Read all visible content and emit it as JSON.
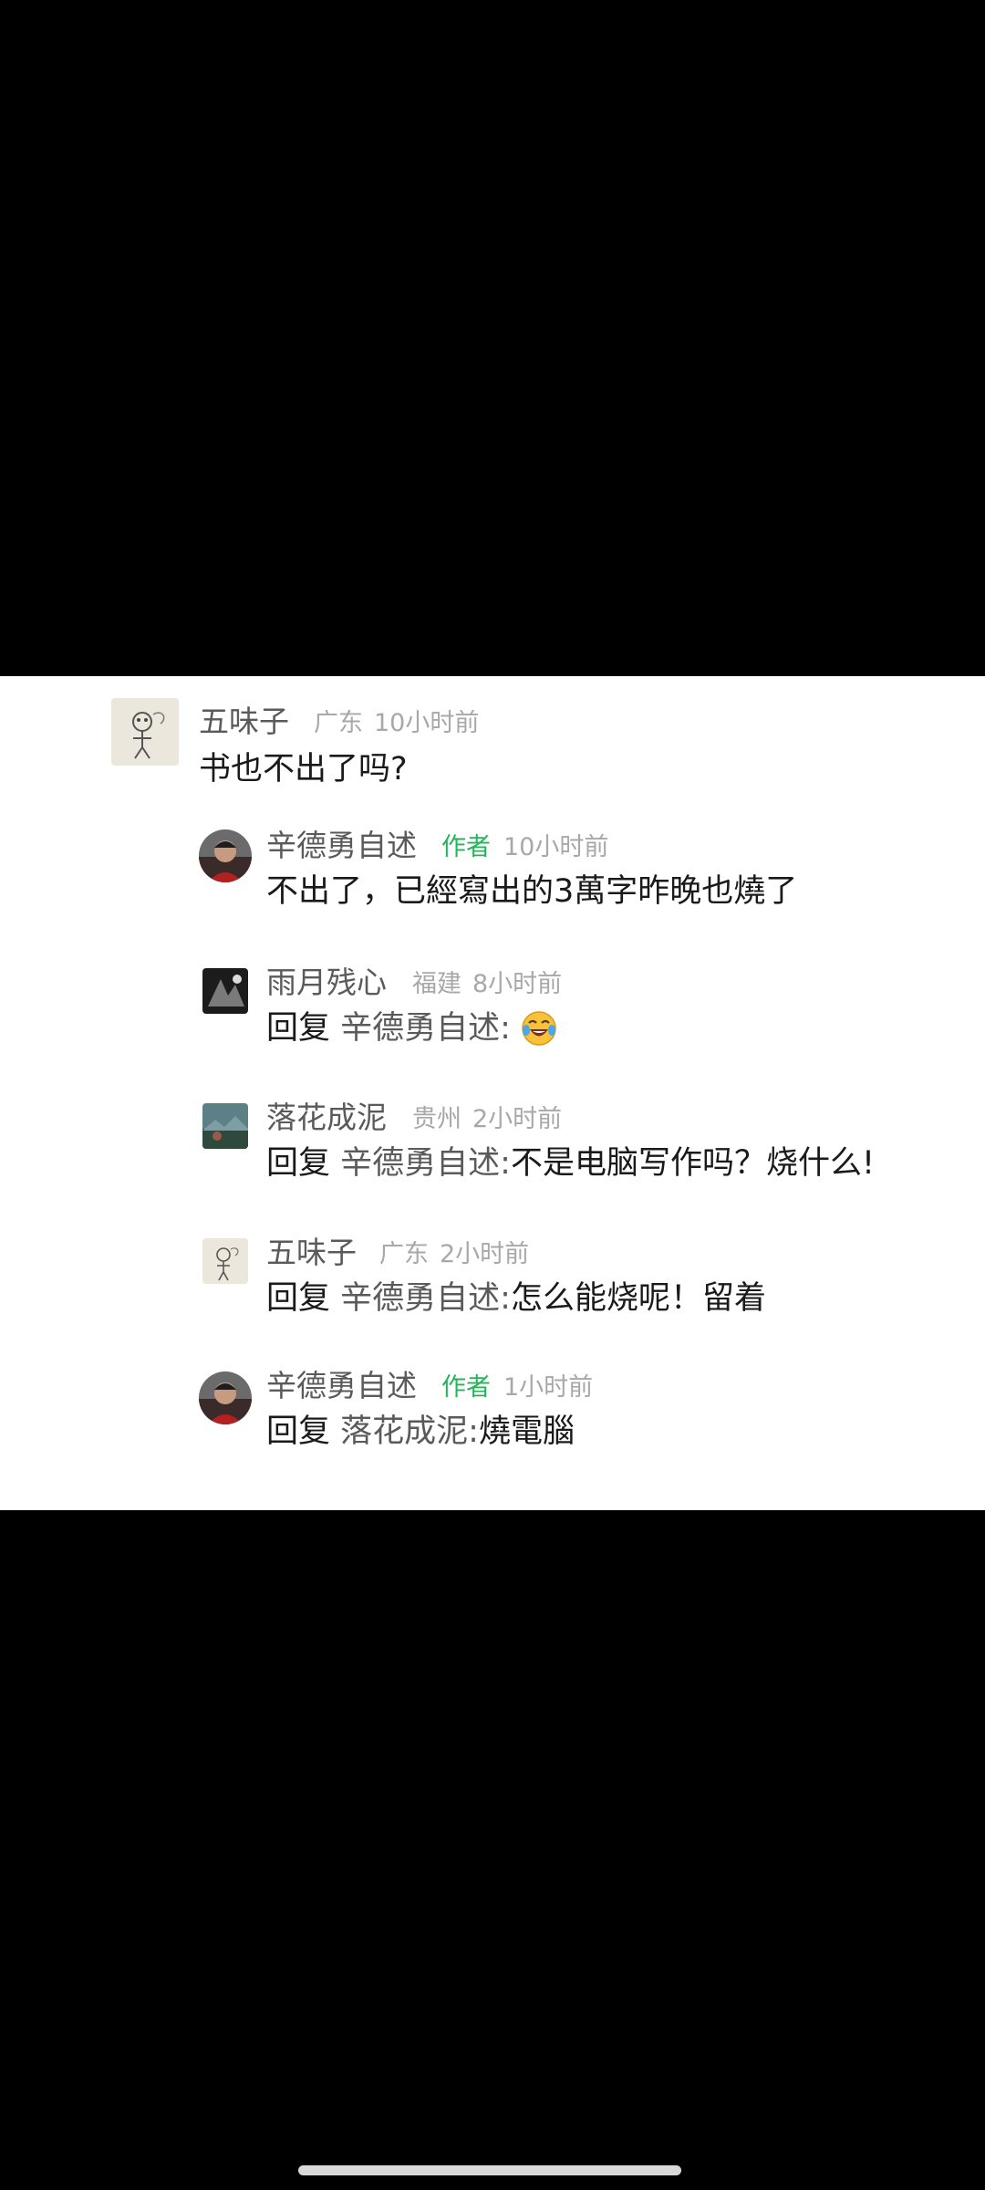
{
  "comments": [
    {
      "user": "五味子",
      "location": "广东",
      "time": "10小时前",
      "text": "书也不出了吗?",
      "avatar": "sketch-avatar"
    },
    {
      "user": "辛德勇自述",
      "tag": "作者",
      "time": "10小时前",
      "text": "不出了，已經寫出的3萬字昨晚也燒了",
      "avatar": "man-portrait-avatar"
    },
    {
      "user": "雨月残心",
      "location": "福建",
      "time": "8小时前",
      "reply_prefix": "回复",
      "reply_target": "辛德勇自述:",
      "text": "",
      "emoji": "laughing-crying-emoji",
      "avatar": "dark-photo-avatar"
    },
    {
      "user": "落花成泥",
      "location": "贵州",
      "time": "2小时前",
      "reply_prefix": "回复",
      "reply_target": "辛德勇自述:",
      "text": "不是电脑写作吗？烧什么!",
      "avatar": "landscape-avatar"
    },
    {
      "user": "五味子",
      "location": "广东",
      "time": "2小时前",
      "reply_prefix": "回复",
      "reply_target": "辛德勇自述:",
      "text": "怎么能烧呢！留着",
      "avatar": "sketch-avatar"
    },
    {
      "user": "辛德勇自述",
      "tag": "作者",
      "time": "1小时前",
      "reply_prefix": "回复",
      "reply_target": "落花成泥:",
      "text": "燒電腦",
      "avatar": "man-portrait-avatar"
    }
  ],
  "colors": {
    "author_tag": "#27b35a",
    "name": "#5a5a5a",
    "meta": "#a8a8a8",
    "text": "#1a1a1a"
  }
}
